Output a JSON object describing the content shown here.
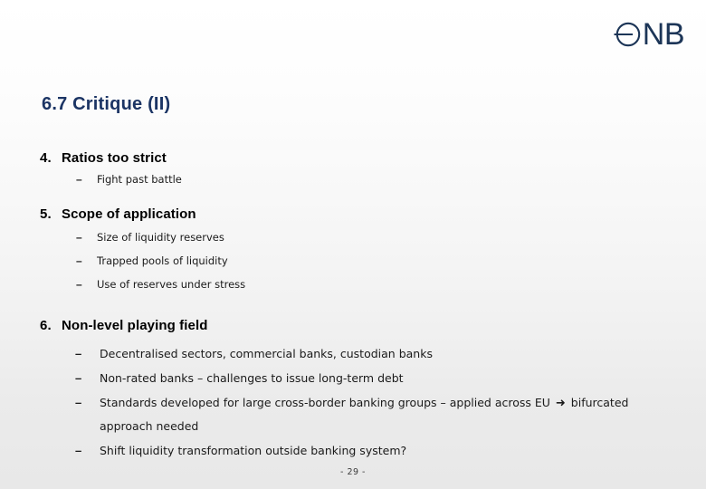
{
  "logo": {
    "mark_icon": "oenb-circle-mark-icon",
    "text": "NB",
    "color": "#1c3557"
  },
  "title": {
    "text": "6.7 Critique (II)",
    "color": "#1b3464"
  },
  "sections": [
    {
      "number": "4.",
      "label": "Ratios too strict",
      "bullets": [
        {
          "dash": "–",
          "text": "Fight past battle"
        }
      ]
    },
    {
      "number": "5.",
      "label": "Scope of application",
      "bullets": [
        {
          "dash": "–",
          "text": "Size of liquidity reserves"
        },
        {
          "dash": "–",
          "text": "Trapped pools of liquidity"
        },
        {
          "dash": "–",
          "text": "Use of reserves under stress"
        }
      ]
    },
    {
      "number": "6.",
      "label": "Non-level playing field",
      "bullets": [
        {
          "dash": "–",
          "text": "Decentralised sectors, commercial banks, custodian banks"
        },
        {
          "dash": "–",
          "text": "Non-rated banks – challenges to issue long-term debt"
        },
        {
          "dash": "–",
          "text_before_arrow": "Standards developed for large cross-border banking groups – applied across EU ",
          "arrow": "➜",
          "text_after_arrow": " bifurcated approach needed"
        },
        {
          "dash": "–",
          "text": "Shift liquidity transformation outside banking system?"
        }
      ]
    }
  ],
  "footer": {
    "page_number": "- 29 -"
  },
  "background": {
    "top_color": "#ffffff",
    "bottom_color": "#e8e8e8"
  }
}
